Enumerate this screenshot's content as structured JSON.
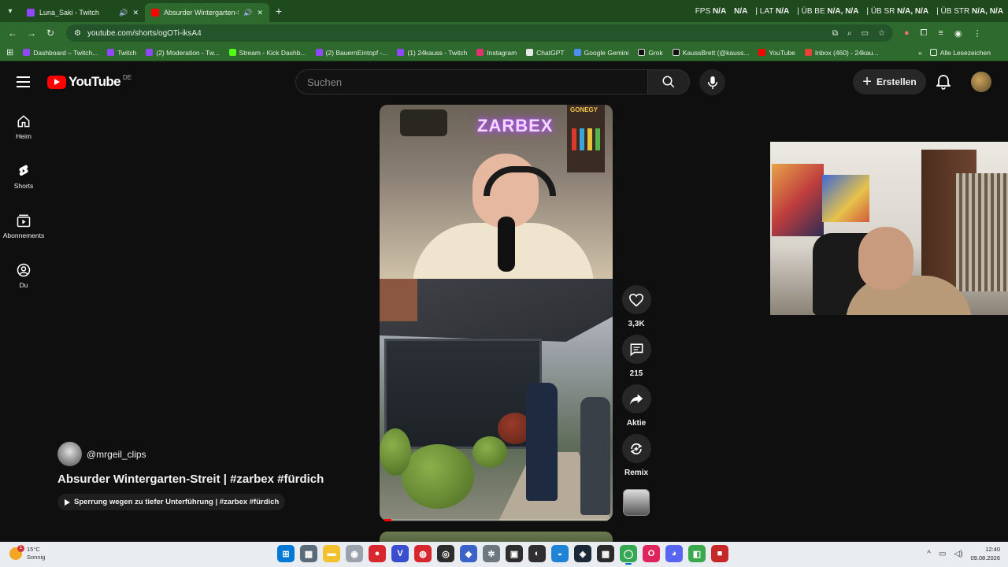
{
  "browser": {
    "tabs": [
      {
        "title": "Luna_Saki - Twitch",
        "color": "#9146ff"
      },
      {
        "title": "Absurder Wintergarten-Str",
        "color": "#ff0000"
      }
    ],
    "new_tab_label": "+",
    "url": "youtube.com/shorts/ogOTi-iksA4",
    "obs_overlay": [
      {
        "label": "FPS",
        "value": "N/A"
      },
      {
        "label": "N/A",
        "value": ""
      },
      {
        "label": "LAT",
        "value": "N/A"
      },
      {
        "label": "ÜB BE",
        "value": "N/A, N/A"
      },
      {
        "label": "ÜB SR",
        "value": "N/A, N/A"
      },
      {
        "label": "ÜB STR",
        "value": "N/A, N/A"
      }
    ],
    "bookmarks": [
      {
        "label": "Dashboard – Twitch...",
        "color": "#9146ff"
      },
      {
        "label": "Twitch",
        "color": "#9146ff"
      },
      {
        "label": "(2) Moderation - Tw...",
        "color": "#9146ff"
      },
      {
        "label": "Stream - Kick Dashb...",
        "color": "#53fc18"
      },
      {
        "label": "(2) BauernEintopf -...",
        "color": "#9146ff"
      },
      {
        "label": "(1) 24kauss - Twitch",
        "color": "#9146ff"
      },
      {
        "label": "Instagram",
        "color": "#e1306c"
      },
      {
        "label": "ChatGPT",
        "color": "#e8e8e8"
      },
      {
        "label": "Google Gemini",
        "color": "#4c8df6"
      },
      {
        "label": "Grok",
        "color": "#111111"
      },
      {
        "label": "KaussBrett (@kauss...",
        "color": "#111111"
      },
      {
        "label": "YouTube",
        "color": "#ff0000"
      },
      {
        "label": "Inbox (460) - 24kau...",
        "color": "#ea4335"
      }
    ],
    "bookmarks_overflow": "»",
    "all_bookmarks_label": "Alle Lesezeichen"
  },
  "youtube": {
    "logo_text": "YouTube",
    "country_code": "DE",
    "search_placeholder": "Suchen",
    "create_label": "Erstellen",
    "sidebar": [
      {
        "label": "Heim",
        "icon": "home-icon"
      },
      {
        "label": "Shorts",
        "icon": "shorts-icon"
      },
      {
        "label": "Abonnements",
        "icon": "subscriptions-icon"
      },
      {
        "label": "Du",
        "icon": "you-icon"
      }
    ],
    "video_overlay_text": "ZARBEX",
    "shelf_text": "GONEGY",
    "actions": {
      "like_count": "3,3K",
      "comment_count": "215",
      "share_label": "Aktie",
      "remix_label": "Remix"
    },
    "channel": "@mrgeil_clips",
    "video_title": "Absurder Wintergarten-Streit | #zarbex  #fürdich",
    "related_chip": "Sperrung wegen zu tiefer Unterführung | #zarbex #fürdich",
    "progress_fraction": 0.03
  },
  "taskbar": {
    "weather_temp": "15°C",
    "weather_desc": "Sonnig",
    "weather_badge": "1",
    "time": "12:40",
    "date": "09.08.2026",
    "apps": [
      {
        "name": "start-icon",
        "color": "#0078d4",
        "glyph": "⊞"
      },
      {
        "name": "calculator-icon",
        "color": "#5c6b7a",
        "glyph": "▦"
      },
      {
        "name": "file-explorer-icon",
        "color": "#f2c12e",
        "glyph": "▬"
      },
      {
        "name": "mouse-app-icon",
        "color": "#9aa3ad",
        "glyph": "◉"
      },
      {
        "name": "red-app-icon",
        "color": "#d8262f",
        "glyph": "●"
      },
      {
        "name": "v-app-icon",
        "color": "#3a4fd0",
        "glyph": "V"
      },
      {
        "name": "record-app-icon",
        "color": "#d8262f",
        "glyph": "◍"
      },
      {
        "name": "target-app-icon",
        "color": "#2c2c2c",
        "glyph": "◎"
      },
      {
        "name": "game-controller-icon",
        "color": "#3a62c8",
        "glyph": "◆"
      },
      {
        "name": "gear-app-icon",
        "color": "#6d7780",
        "glyph": "✲"
      },
      {
        "name": "streamer-app-icon",
        "color": "#2d2d2d",
        "glyph": "▣"
      },
      {
        "name": "obs-icon",
        "color": "#302e31",
        "glyph": "◐"
      },
      {
        "name": "edge-app-icon",
        "color": "#1f84d6",
        "glyph": "◒"
      },
      {
        "name": "steam-icon",
        "color": "#1b2838",
        "glyph": "◈"
      },
      {
        "name": "capture-app-icon",
        "color": "#2a2a2a",
        "glyph": "▩"
      },
      {
        "name": "chrome-icon",
        "color": "#34a853",
        "glyph": "◯",
        "active": true
      },
      {
        "name": "opera-icon",
        "color": "#e0245e",
        "glyph": "O"
      },
      {
        "name": "discord-icon",
        "color": "#5865f2",
        "glyph": "◕"
      },
      {
        "name": "colors-app-icon",
        "color": "#3aa84c",
        "glyph": "◧"
      },
      {
        "name": "red-square-app-icon",
        "color": "#c62828",
        "glyph": "■"
      }
    ]
  }
}
